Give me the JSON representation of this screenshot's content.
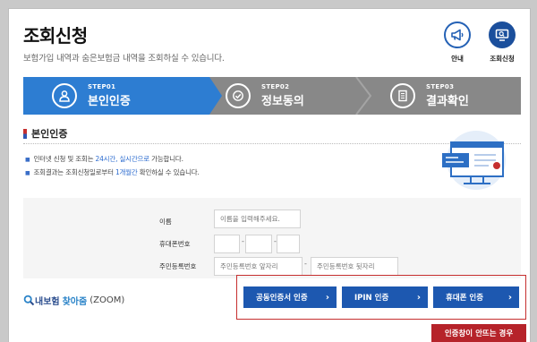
{
  "header": {
    "title": "조회신청",
    "subtitle": "보험가입 내역과 숨은보험금 내역을 조회하실 수 있습니다."
  },
  "top_buttons": {
    "guide": {
      "label": "안내",
      "icon": "megaphone-icon"
    },
    "request": {
      "label": "조회신청",
      "icon": "monitor-icon"
    }
  },
  "steps": [
    {
      "step": "STEP01",
      "name": "본인인증",
      "icon": "person-icon",
      "active": true
    },
    {
      "step": "STEP02",
      "name": "정보동의",
      "icon": "check-circle-icon",
      "active": false
    },
    {
      "step": "STEP03",
      "name": "결과확인",
      "icon": "document-icon",
      "active": false
    }
  ],
  "section": {
    "title": "본인인증",
    "info1": {
      "pre": "인터넷 신청 및 조회는 ",
      "highlight": "24시간, 실시간으로",
      "post": " 가능합니다."
    },
    "info2": {
      "pre": "조회결과는 조회신청일로부터 ",
      "highlight": "1개월간",
      "post": " 확인하실 수 있습니다."
    }
  },
  "form": {
    "name_label": "이름",
    "name_placeholder": "이름을 입력해주세요.",
    "phone_label": "휴대폰번호",
    "phone_sep": "-",
    "rrn_label": "주민등록번호",
    "rrn_front_placeholder": "주민등록번호 앞자리",
    "rrn_back_placeholder": "주민등록번호 뒷자리",
    "rrn_sep": "-"
  },
  "zoom": {
    "part1": "내보험",
    "part2": "찾아줌",
    "part3": "(ZOOM)"
  },
  "auth_buttons": {
    "cert": "공동인증서 인증",
    "ipin": "IPIN 인증",
    "phone": "휴대폰 인증",
    "arrow": "›"
  },
  "error_button": "인증창이 안뜨는 경우",
  "colors": {
    "primary": "#2d7dd2",
    "button": "#1d58b0",
    "inactive_step": "#888888",
    "highlight_box": "#c62f2f",
    "error_button": "#b6232a"
  }
}
